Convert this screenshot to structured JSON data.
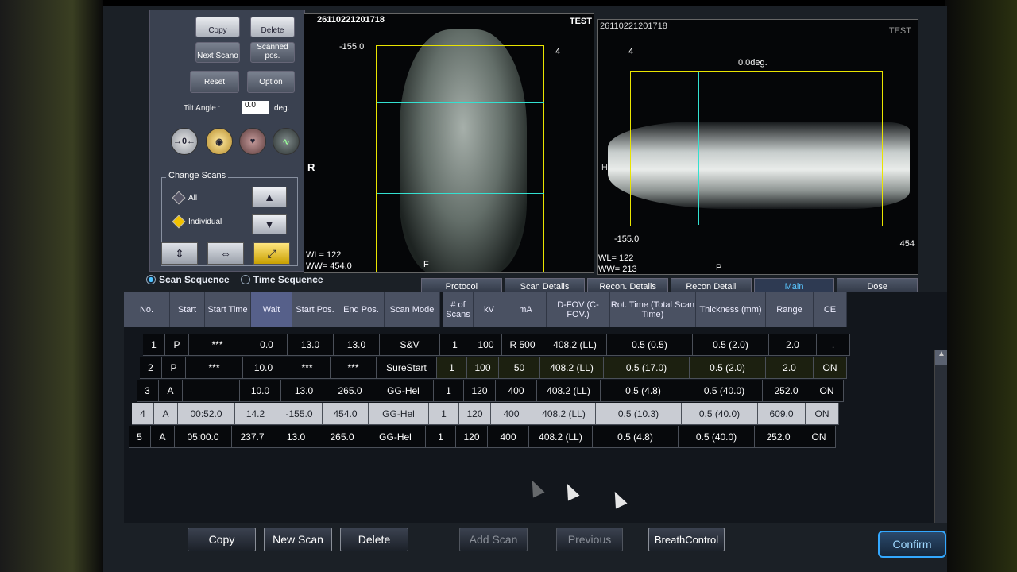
{
  "toolbar": {
    "copy": "Copy",
    "delete": "Delete",
    "next_scano": "Next Scano",
    "scanned_pos": "Scanned pos.",
    "reset": "Reset",
    "option": "Option"
  },
  "tilt": {
    "label": "Tilt Angle :",
    "value": "0.0",
    "unit": "deg."
  },
  "icons": [
    "focus-icon",
    "voice-icon",
    "heart-icon",
    "mA-icon"
  ],
  "change_scans": {
    "title": "Change Scans",
    "all": "All",
    "individual": "Individual"
  },
  "viewer_front": {
    "id": "26110221201718",
    "tag": "TEST",
    "top_value": "-155.0",
    "side_label": "R",
    "bottom_label": "F",
    "wl": "WL= 122",
    "ww": "WW= 454.0",
    "marker": "4"
  },
  "viewer_side": {
    "id": "26110221201718",
    "tag": "TEST",
    "angle": "0.0deg.",
    "side_label": "H",
    "bottom_left": "-155.0",
    "bottom_right": "454",
    "bottom_label": "P",
    "wl": "WL= 122",
    "ww": "WW= 213",
    "marker": "4"
  },
  "sequence": {
    "scan_sequence": "Scan Sequence",
    "time_sequence": "Time Sequence"
  },
  "tabs": [
    "Protocol",
    "Scan Details",
    "Recon. Details",
    "Recon Detail",
    "Main",
    "Dose"
  ],
  "columns_left": [
    "No.",
    "Start",
    "Start Time",
    "Wait",
    "Start Pos.",
    "End Pos.",
    "Scan Mode"
  ],
  "columns_right": [
    "# of Scans",
    "kV",
    "mA",
    "D-FOV (C-FOV.)",
    "Rot. Time (Total Scan Time)",
    "Thickness (mm)",
    "Range",
    "CE"
  ],
  "rows": [
    {
      "no": "1",
      "start": "P",
      "time": "***",
      "wait": "0.0",
      "spos": "13.0",
      "epos": "13.0",
      "mode": "S&V",
      "scans": "1",
      "kv": "100",
      "ma": "R 500",
      "dfov": "408.2 (LL)",
      "rot": "0.5 (0.5)",
      "thick": "0.5 (2.0)",
      "range": "2.0",
      "ce": "."
    },
    {
      "no": "2",
      "start": "P",
      "time": "***",
      "wait": "10.0",
      "spos": "***",
      "epos": "***",
      "mode": "SureStart",
      "scans": "1",
      "kv": "100",
      "ma": "50",
      "dfov": "408.2 (LL)",
      "rot": "0.5 (17.0)",
      "thick": "0.5 (2.0)",
      "range": "2.0",
      "ce": "ON"
    },
    {
      "no": "3",
      "start": "A",
      "time": "",
      "wait": "10.0",
      "spos": "13.0",
      "epos": "265.0",
      "mode": "GG-Hel",
      "scans": "1",
      "kv": "120",
      "ma": "400",
      "dfov": "408.2 (LL)",
      "rot": "0.5 (4.8)",
      "thick": "0.5 (40.0)",
      "range": "252.0",
      "ce": "ON"
    },
    {
      "no": "4",
      "start": "A",
      "time": "00:52.0",
      "wait": "14.2",
      "spos": "-155.0",
      "epos": "454.0",
      "mode": "GG-Hel",
      "scans": "1",
      "kv": "120",
      "ma": "400",
      "dfov": "408.2 (LL)",
      "rot": "0.5 (10.3)",
      "thick": "0.5 (40.0)",
      "range": "609.0",
      "ce": "ON"
    },
    {
      "no": "5",
      "start": "A",
      "time": "05:00.0",
      "wait": "237.7",
      "spos": "13.0",
      "epos": "265.0",
      "mode": "GG-Hel",
      "scans": "1",
      "kv": "120",
      "ma": "400",
      "dfov": "408.2 (LL)",
      "rot": "0.5 (4.8)",
      "thick": "0.5 (40.0)",
      "range": "252.0",
      "ce": "ON"
    }
  ],
  "bottom": {
    "copy": "Copy",
    "new_scan": "New Scan",
    "delete": "Delete",
    "add_scan": "Add Scan",
    "previous": "Previous",
    "breath": "BreathControl",
    "confirm": "Confirm"
  }
}
